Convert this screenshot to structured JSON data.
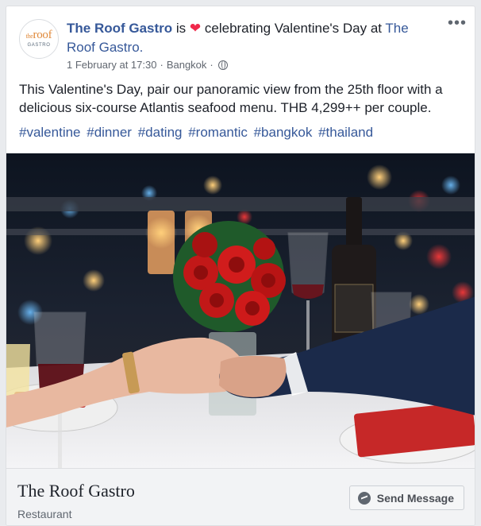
{
  "post": {
    "page_name": "The Roof Gastro",
    "feeling_prefix": " is ",
    "feeling_text": " celebrating Valentine's Day at ",
    "location_page": "The Roof Gastro.",
    "date": "1 February at 17:30",
    "separator": " · ",
    "place": "Bangkok",
    "separator2": " · ",
    "body": "This Valentine's Day, pair our panoramic view from the 25th floor with a delicious six-course Atlantis seafood menu. THB 4,299++ per couple.",
    "hashtags": [
      "#valentine",
      "#dinner",
      "#dating",
      "#romantic",
      "#bangkok",
      "#thailand"
    ],
    "more_label": "•••"
  },
  "avatar": {
    "logo_prefix": "the",
    "logo_main": "roof",
    "logo_sub": "GASTRO"
  },
  "footer": {
    "title": "The Roof Gastro",
    "category": "Restaurant",
    "send_label": "Send Message"
  },
  "colors": {
    "link": "#365899",
    "heart": "#f0284a",
    "footer_bg": "#f2f3f5"
  },
  "icons": [
    "heart-icon",
    "globe-icon",
    "more-icon",
    "messenger-icon"
  ]
}
